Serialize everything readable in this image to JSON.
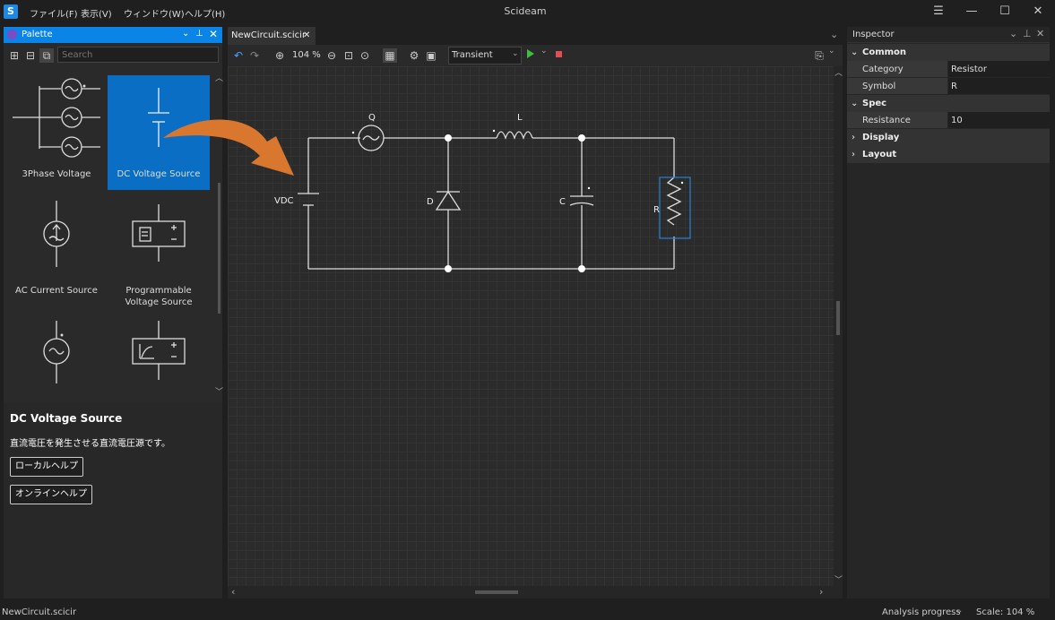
{
  "app": {
    "title": "Scideam",
    "logo": "S"
  },
  "menu": [
    "ファイル(F)",
    "表示(V)",
    "ウィンドウ(W)",
    "ヘルプ(H)"
  ],
  "palette": {
    "title": "Palette",
    "search_placeholder": "Search",
    "items": [
      {
        "label": "3Phase Voltage",
        "selected": false
      },
      {
        "label": "DC Voltage Source",
        "selected": true
      },
      {
        "label": "AC Current Source",
        "selected": false
      },
      {
        "label": "Programmable Voltage Source",
        "selected": false
      },
      {
        "label": "",
        "selected": false
      },
      {
        "label": "",
        "selected": false
      }
    ],
    "description": {
      "title": "DC Voltage Source",
      "text": "直流電圧を発生させる直流電圧源です。",
      "local_help": "ローカルヘルプ",
      "online_help": "オンラインヘルプ"
    }
  },
  "editor": {
    "tab": "NewCircuit.scicir",
    "zoom": "104 %",
    "analysis_mode": "Transient",
    "components": {
      "source": "VDC",
      "switch": "Q",
      "inductor": "L",
      "diode": "D",
      "capacitor": "C",
      "resistor": "R"
    }
  },
  "inspector": {
    "title": "Inspector",
    "sections": [
      {
        "name": "Common",
        "expanded": true,
        "props": [
          {
            "name": "Category",
            "value": "Resistor"
          },
          {
            "name": "Symbol",
            "value": "R"
          }
        ]
      },
      {
        "name": "Spec",
        "expanded": true,
        "props": [
          {
            "name": "Resistance",
            "value": "10"
          }
        ]
      },
      {
        "name": "Display",
        "expanded": false,
        "props": []
      },
      {
        "name": "Layout",
        "expanded": false,
        "props": []
      }
    ]
  },
  "status": {
    "file": "NewCircuit.scicir",
    "analysis_progress": "Analysis progress",
    "scale": "Scale:  104 %"
  },
  "colors": {
    "accent": "#0a84e6",
    "selection": "#0a6fc4",
    "arrow": "#d9772e",
    "run": "#3fbf3f",
    "stop": "#e05050"
  }
}
